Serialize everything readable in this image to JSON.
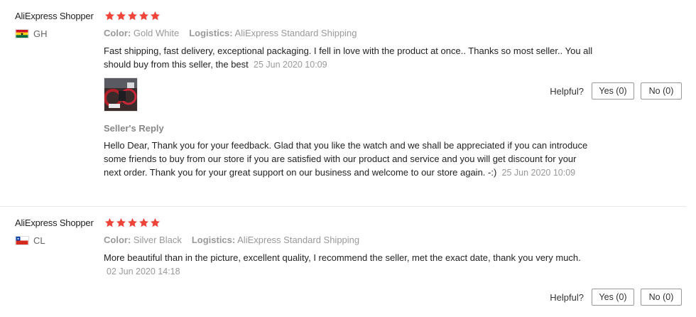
{
  "reviews": [
    {
      "user": "AliExpress Shopper",
      "rating": 5,
      "country_code": "GH",
      "color_label": "Color:",
      "color_value": "Gold White",
      "logistics_label": "Logistics:",
      "logistics_value": "AliExpress Standard Shipping",
      "text": "Fast shipping, fast delivery, exceptional packaging. I fell in love with the product at once.. Thanks so most seller.. You all should buy from this seller, the best",
      "date": "25 Jun 2020 10:09",
      "has_photo": true,
      "helpful_label": "Helpful?",
      "yes_label": "Yes (0)",
      "no_label": "No (0)",
      "reply_title": "Seller's Reply",
      "reply_text": "Hello Dear, Thank you for your feedback. Glad that you like the watch and we shall be appreciated if you can introduce some friends to buy from our store if you are satisfied with our product and service and you will get discount for your next order. Thank you for your great support on our business and welcome to our store again. -:)",
      "reply_date": "25 Jun 2020 10:09"
    },
    {
      "user": "AliExpress Shopper",
      "rating": 5,
      "country_code": "CL",
      "color_label": "Color:",
      "color_value": "Silver Black",
      "logistics_label": "Logistics:",
      "logistics_value": "AliExpress Standard Shipping",
      "text": "More beautiful than in the picture, excellent quality, I recommend the seller, met the exact date, thank you very much.",
      "date": "02 Jun 2020 14:18",
      "helpful_label": "Helpful?",
      "yes_label": "Yes (0)",
      "no_label": "No (0)"
    }
  ],
  "colors": {
    "star": "#f0443b",
    "text": "#222222",
    "muted": "#999999"
  }
}
